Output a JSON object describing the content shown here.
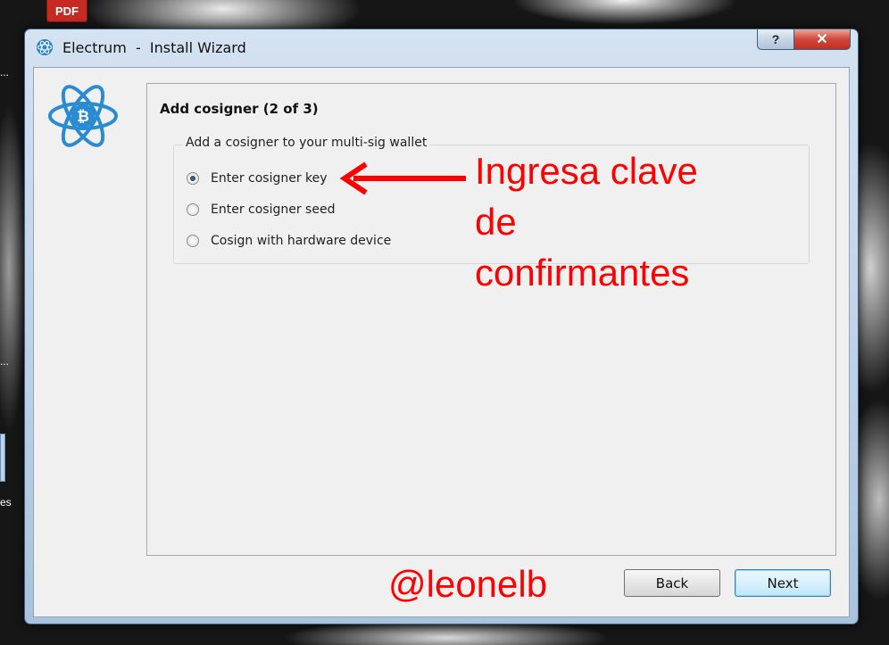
{
  "desktop": {
    "pdf_icon_label": "PDF",
    "fragment_1": "...",
    "fragment_2": "es"
  },
  "window": {
    "app_name": "Electrum",
    "title_separator": "-",
    "title_suffix": "Install Wizard",
    "help_label": "?",
    "close_label": "✕"
  },
  "wizard": {
    "page_title": "Add cosigner (2 of 3)",
    "group_title": "Add a cosigner to your multi-sig wallet",
    "options": [
      {
        "label": "Enter cosigner key",
        "selected": true
      },
      {
        "label": "Enter cosigner seed",
        "selected": false
      },
      {
        "label": "Cosign with hardware device",
        "selected": false
      }
    ],
    "back_label": "Back",
    "next_label": "Next"
  },
  "annotations": {
    "main_line1": "Ingresa clave",
    "main_line2": "de",
    "main_line3": "confirmantes",
    "handle": "@leonelb",
    "color": "#ff0000"
  },
  "icons": {
    "app": "electrum-logo-icon",
    "logo": "electrum-atom-bitcoin-icon"
  }
}
